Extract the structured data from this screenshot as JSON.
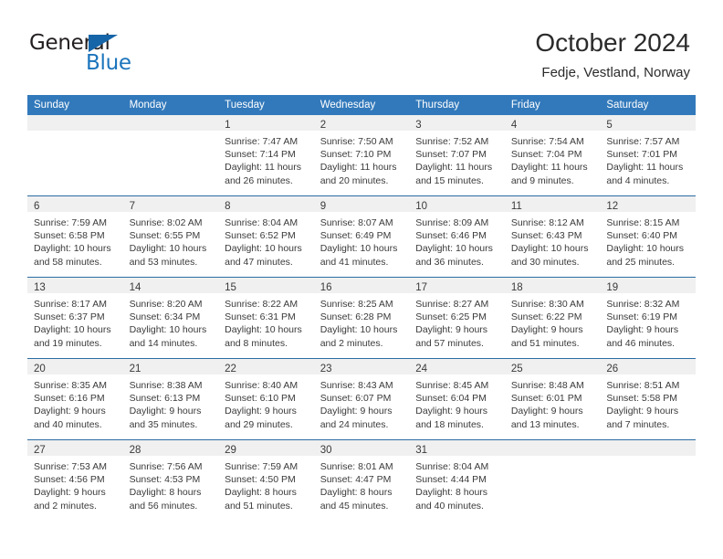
{
  "brand": {
    "name_top": "General",
    "name_bottom": "Blue",
    "accent_color": "#1b74bc",
    "triangle_color": "#1565a8"
  },
  "header": {
    "title": "October 2024",
    "subtitle": "Fedje, Vestland, Norway"
  },
  "theme": {
    "header_row_bg": "#3279bb",
    "day_band_bg": "#f0f0f0",
    "week_divider": "#2b6ca3",
    "text_color": "#3a3a3a"
  },
  "weekday_headers": [
    "Sunday",
    "Monday",
    "Tuesday",
    "Wednesday",
    "Thursday",
    "Friday",
    "Saturday"
  ],
  "labels": {
    "sunrise_prefix": "Sunrise:",
    "sunset_prefix": "Sunset:",
    "daylight_prefix": "Daylight:"
  },
  "weeks": [
    [
      {
        "day": "",
        "sunrise": "",
        "sunset": "",
        "daylight_a": "",
        "daylight_b": ""
      },
      {
        "day": "",
        "sunrise": "",
        "sunset": "",
        "daylight_a": "",
        "daylight_b": ""
      },
      {
        "day": "1",
        "sunrise": "Sunrise: 7:47 AM",
        "sunset": "Sunset: 7:14 PM",
        "daylight_a": "Daylight: 11 hours",
        "daylight_b": "and 26 minutes."
      },
      {
        "day": "2",
        "sunrise": "Sunrise: 7:50 AM",
        "sunset": "Sunset: 7:10 PM",
        "daylight_a": "Daylight: 11 hours",
        "daylight_b": "and 20 minutes."
      },
      {
        "day": "3",
        "sunrise": "Sunrise: 7:52 AM",
        "sunset": "Sunset: 7:07 PM",
        "daylight_a": "Daylight: 11 hours",
        "daylight_b": "and 15 minutes."
      },
      {
        "day": "4",
        "sunrise": "Sunrise: 7:54 AM",
        "sunset": "Sunset: 7:04 PM",
        "daylight_a": "Daylight: 11 hours",
        "daylight_b": "and 9 minutes."
      },
      {
        "day": "5",
        "sunrise": "Sunrise: 7:57 AM",
        "sunset": "Sunset: 7:01 PM",
        "daylight_a": "Daylight: 11 hours",
        "daylight_b": "and 4 minutes."
      }
    ],
    [
      {
        "day": "6",
        "sunrise": "Sunrise: 7:59 AM",
        "sunset": "Sunset: 6:58 PM",
        "daylight_a": "Daylight: 10 hours",
        "daylight_b": "and 58 minutes."
      },
      {
        "day": "7",
        "sunrise": "Sunrise: 8:02 AM",
        "sunset": "Sunset: 6:55 PM",
        "daylight_a": "Daylight: 10 hours",
        "daylight_b": "and 53 minutes."
      },
      {
        "day": "8",
        "sunrise": "Sunrise: 8:04 AM",
        "sunset": "Sunset: 6:52 PM",
        "daylight_a": "Daylight: 10 hours",
        "daylight_b": "and 47 minutes."
      },
      {
        "day": "9",
        "sunrise": "Sunrise: 8:07 AM",
        "sunset": "Sunset: 6:49 PM",
        "daylight_a": "Daylight: 10 hours",
        "daylight_b": "and 41 minutes."
      },
      {
        "day": "10",
        "sunrise": "Sunrise: 8:09 AM",
        "sunset": "Sunset: 6:46 PM",
        "daylight_a": "Daylight: 10 hours",
        "daylight_b": "and 36 minutes."
      },
      {
        "day": "11",
        "sunrise": "Sunrise: 8:12 AM",
        "sunset": "Sunset: 6:43 PM",
        "daylight_a": "Daylight: 10 hours",
        "daylight_b": "and 30 minutes."
      },
      {
        "day": "12",
        "sunrise": "Sunrise: 8:15 AM",
        "sunset": "Sunset: 6:40 PM",
        "daylight_a": "Daylight: 10 hours",
        "daylight_b": "and 25 minutes."
      }
    ],
    [
      {
        "day": "13",
        "sunrise": "Sunrise: 8:17 AM",
        "sunset": "Sunset: 6:37 PM",
        "daylight_a": "Daylight: 10 hours",
        "daylight_b": "and 19 minutes."
      },
      {
        "day": "14",
        "sunrise": "Sunrise: 8:20 AM",
        "sunset": "Sunset: 6:34 PM",
        "daylight_a": "Daylight: 10 hours",
        "daylight_b": "and 14 minutes."
      },
      {
        "day": "15",
        "sunrise": "Sunrise: 8:22 AM",
        "sunset": "Sunset: 6:31 PM",
        "daylight_a": "Daylight: 10 hours",
        "daylight_b": "and 8 minutes."
      },
      {
        "day": "16",
        "sunrise": "Sunrise: 8:25 AM",
        "sunset": "Sunset: 6:28 PM",
        "daylight_a": "Daylight: 10 hours",
        "daylight_b": "and 2 minutes."
      },
      {
        "day": "17",
        "sunrise": "Sunrise: 8:27 AM",
        "sunset": "Sunset: 6:25 PM",
        "daylight_a": "Daylight: 9 hours",
        "daylight_b": "and 57 minutes."
      },
      {
        "day": "18",
        "sunrise": "Sunrise: 8:30 AM",
        "sunset": "Sunset: 6:22 PM",
        "daylight_a": "Daylight: 9 hours",
        "daylight_b": "and 51 minutes."
      },
      {
        "day": "19",
        "sunrise": "Sunrise: 8:32 AM",
        "sunset": "Sunset: 6:19 PM",
        "daylight_a": "Daylight: 9 hours",
        "daylight_b": "and 46 minutes."
      }
    ],
    [
      {
        "day": "20",
        "sunrise": "Sunrise: 8:35 AM",
        "sunset": "Sunset: 6:16 PM",
        "daylight_a": "Daylight: 9 hours",
        "daylight_b": "and 40 minutes."
      },
      {
        "day": "21",
        "sunrise": "Sunrise: 8:38 AM",
        "sunset": "Sunset: 6:13 PM",
        "daylight_a": "Daylight: 9 hours",
        "daylight_b": "and 35 minutes."
      },
      {
        "day": "22",
        "sunrise": "Sunrise: 8:40 AM",
        "sunset": "Sunset: 6:10 PM",
        "daylight_a": "Daylight: 9 hours",
        "daylight_b": "and 29 minutes."
      },
      {
        "day": "23",
        "sunrise": "Sunrise: 8:43 AM",
        "sunset": "Sunset: 6:07 PM",
        "daylight_a": "Daylight: 9 hours",
        "daylight_b": "and 24 minutes."
      },
      {
        "day": "24",
        "sunrise": "Sunrise: 8:45 AM",
        "sunset": "Sunset: 6:04 PM",
        "daylight_a": "Daylight: 9 hours",
        "daylight_b": "and 18 minutes."
      },
      {
        "day": "25",
        "sunrise": "Sunrise: 8:48 AM",
        "sunset": "Sunset: 6:01 PM",
        "daylight_a": "Daylight: 9 hours",
        "daylight_b": "and 13 minutes."
      },
      {
        "day": "26",
        "sunrise": "Sunrise: 8:51 AM",
        "sunset": "Sunset: 5:58 PM",
        "daylight_a": "Daylight: 9 hours",
        "daylight_b": "and 7 minutes."
      }
    ],
    [
      {
        "day": "27",
        "sunrise": "Sunrise: 7:53 AM",
        "sunset": "Sunset: 4:56 PM",
        "daylight_a": "Daylight: 9 hours",
        "daylight_b": "and 2 minutes."
      },
      {
        "day": "28",
        "sunrise": "Sunrise: 7:56 AM",
        "sunset": "Sunset: 4:53 PM",
        "daylight_a": "Daylight: 8 hours",
        "daylight_b": "and 56 minutes."
      },
      {
        "day": "29",
        "sunrise": "Sunrise: 7:59 AM",
        "sunset": "Sunset: 4:50 PM",
        "daylight_a": "Daylight: 8 hours",
        "daylight_b": "and 51 minutes."
      },
      {
        "day": "30",
        "sunrise": "Sunrise: 8:01 AM",
        "sunset": "Sunset: 4:47 PM",
        "daylight_a": "Daylight: 8 hours",
        "daylight_b": "and 45 minutes."
      },
      {
        "day": "31",
        "sunrise": "Sunrise: 8:04 AM",
        "sunset": "Sunset: 4:44 PM",
        "daylight_a": "Daylight: 8 hours",
        "daylight_b": "and 40 minutes."
      },
      {
        "day": "",
        "sunrise": "",
        "sunset": "",
        "daylight_a": "",
        "daylight_b": ""
      },
      {
        "day": "",
        "sunrise": "",
        "sunset": "",
        "daylight_a": "",
        "daylight_b": ""
      }
    ]
  ]
}
